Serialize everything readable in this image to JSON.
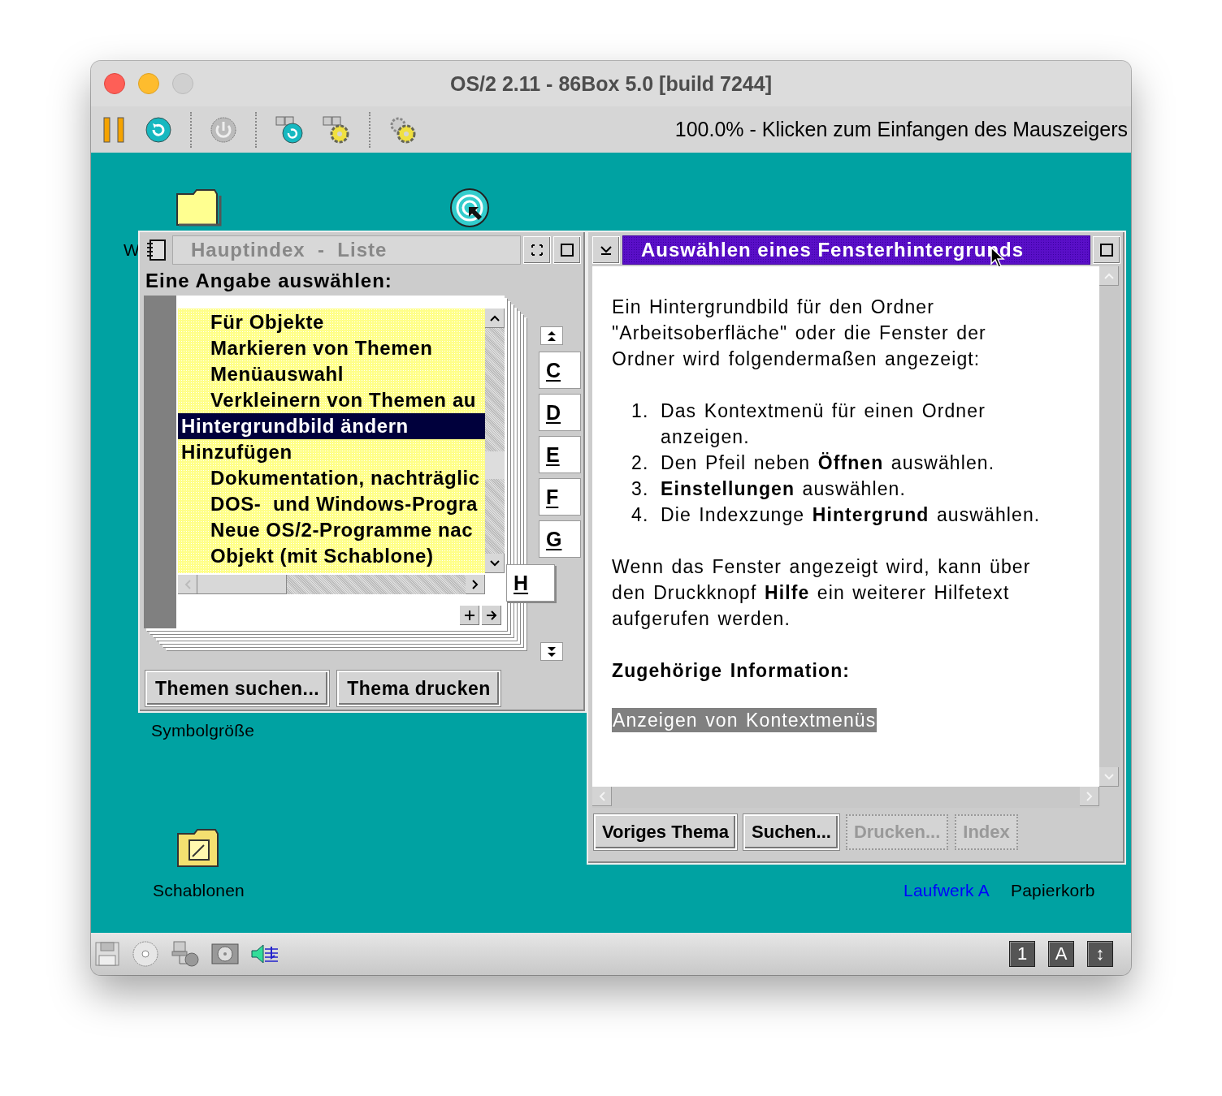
{
  "window": {
    "title": "OS/2 2.11 - 86Box 5.0 [build 7244]"
  },
  "toolbar": {
    "status_text": "100.0% - Klicken zum Einfangen des Mauszeigers"
  },
  "desktop": {
    "icons": [
      {
        "kind": "folder",
        "label": "W",
        "color": "#000000"
      },
      {
        "kind": "target"
      },
      {
        "kind": "text",
        "label": "Symbolgröße",
        "color": "#000000"
      },
      {
        "kind": "template",
        "label": "Schablonen",
        "color": "#000000"
      },
      {
        "kind": "text",
        "label": "Laufwerk A",
        "color": "#0000ff"
      },
      {
        "kind": "text",
        "label": "Papierkorb",
        "color": "#000000"
      }
    ]
  },
  "index_window": {
    "title": "Hauptindex  -  Liste",
    "active": false,
    "prompt": "Eine Angabe auswählen:",
    "entries": [
      {
        "children": [
          {
            "label": "Für Objekte",
            "selected": false
          },
          {
            "label": "Markieren von Themen",
            "selected": false
          },
          {
            "label": "Menüauswahl",
            "selected": false
          },
          {
            "label": "Verkleinern von Themen au",
            "selected": false
          }
        ]
      },
      {
        "label": "Hintergrundbild ändern",
        "selected": true
      },
      {
        "label": "Hinzufügen",
        "selected": false,
        "children": [
          {
            "label": "Dokumentation, nachträglic",
            "selected": false
          },
          {
            "label": "DOS-  und Windows-Progra",
            "selected": false
          },
          {
            "label": "Neue OS/2-Programme nac",
            "selected": false
          },
          {
            "label": "Objekt (mit Schablone)",
            "selected": false
          }
        ]
      }
    ],
    "tabs": [
      {
        "label": "C",
        "selected": false
      },
      {
        "label": "D",
        "selected": false
      },
      {
        "label": "E",
        "selected": false
      },
      {
        "label": "F",
        "selected": false
      },
      {
        "label": "G",
        "selected": false
      },
      {
        "label": "H",
        "selected": true
      }
    ],
    "buttons": [
      {
        "label": "Themen suchen...",
        "disabled": false
      },
      {
        "label": "Thema drucken",
        "disabled": false
      }
    ]
  },
  "help_window": {
    "title": "Auswählen eines Fensterhintergrunds",
    "active": true,
    "intro": "Ein Hintergrundbild für den Ordner\n\"Arbeitsoberfläche\" oder die Fenster der\nOrdner wird folgendermaßen angezeigt:",
    "steps": [
      {
        "number": "1.",
        "text": "Das Kontextmenü für einen Ordner\nanzeigen."
      },
      {
        "number": "2.",
        "text": "Den Pfeil neben **Öffnen** auswählen."
      },
      {
        "number": "3.",
        "text": "**Einstellungen** auswählen."
      },
      {
        "number": "4.",
        "text": "Die Indexzunge **Hintergrund** auswählen."
      }
    ],
    "note": "Wenn das Fenster angezeigt wird, kann über\nden Druckknopf **Hilfe** ein weiterer Hilfetext\naufgerufen werden.",
    "related_heading": "Zugehörige Information:",
    "links": [
      {
        "label": "Anzeigen von Kontextmenüs",
        "selected": true
      }
    ],
    "buttons": [
      {
        "label": "Voriges Thema",
        "disabled": false
      },
      {
        "label": "Suchen...",
        "disabled": false
      },
      {
        "label": "Drucken...",
        "disabled": true
      },
      {
        "label": "Index",
        "disabled": true
      }
    ]
  },
  "status_bar": {
    "indicators": [
      {
        "label": "1"
      },
      {
        "label": "A"
      },
      {
        "label": "↕"
      }
    ]
  }
}
